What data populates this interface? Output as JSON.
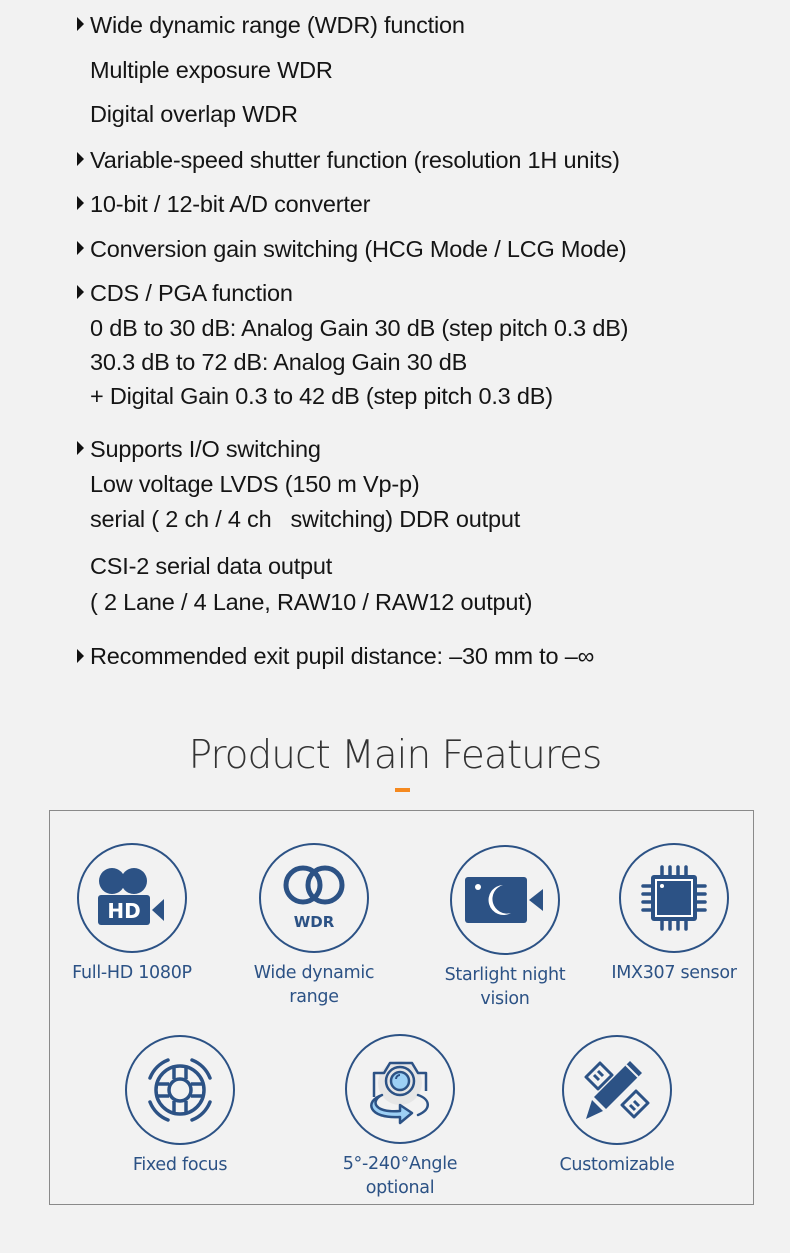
{
  "specs": [
    {
      "text": "Wide dynamic range (WDR) function",
      "bullet": true
    },
    {
      "text": "Multiple exposure WDR",
      "bullet": false
    },
    {
      "text": "Digital overlap WDR",
      "bullet": false
    },
    {
      "text": "Variable-speed shutter function (resolution 1H units)",
      "bullet": true
    },
    {
      "text": "10-bit / 12-bit A/D converter",
      "bullet": true
    },
    {
      "text": "Conversion gain switching (HCG Mode / LCG Mode)",
      "bullet": true
    },
    {
      "text": "CDS / PGA function",
      "bullet": true
    },
    {
      "text": "0 dB to 30 dB: Analog Gain 30 dB (step pitch 0.3 dB)",
      "bullet": false
    },
    {
      "text": "30.3 dB to 72 dB: Analog Gain 30 dB",
      "bullet": false
    },
    {
      "text": "+ Digital Gain 0.3 to 42 dB (step pitch 0.3 dB)",
      "bullet": false
    },
    {
      "text": "Supports I/O switching",
      "bullet": true
    },
    {
      "text": "Low voltage LVDS (150 m Vp-p)",
      "bullet": false
    },
    {
      "text": "serial ( 2 ch / 4 ch   switching) DDR output",
      "bullet": false
    },
    {
      "text": "CSI-2 serial data output",
      "bullet": false
    },
    {
      "text": "( 2 Lane / 4 Lane, RAW10 / RAW12 output)",
      "bullet": false
    },
    {
      "text": "Recommended exit pupil distance: –30 mm to –∞",
      "bullet": true
    }
  ],
  "features_section": {
    "title": "Product Main Features",
    "accent_color": "#f5891f",
    "icon_color": "#2c5285",
    "items": [
      {
        "label": "Full-HD 1080P",
        "icon": "hd-video-camera-icon"
      },
      {
        "label": "Wide dynamic range",
        "icon": "wdr-icon"
      },
      {
        "label": "Starlight night vision",
        "icon": "night-vision-camera-icon"
      },
      {
        "label": "IMX307 sensor",
        "icon": "chip-sensor-icon"
      },
      {
        "label": "Fixed focus",
        "icon": "lifebuoy-focus-icon"
      },
      {
        "label": "5°-240°Angle optional",
        "icon": "rotate-camera-icon"
      },
      {
        "label": "Customizable",
        "icon": "pencil-ruler-icon"
      }
    ]
  }
}
